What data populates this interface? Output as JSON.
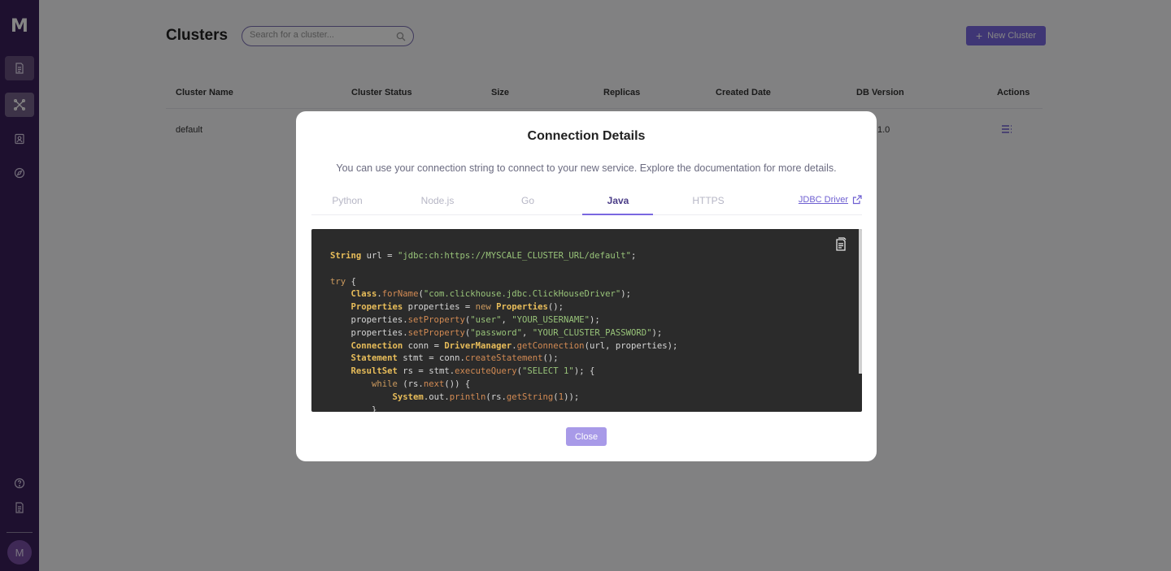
{
  "sidebar": {
    "logo": "M",
    "avatar_initial": "M",
    "items": [
      {
        "icon": "document-icon"
      },
      {
        "icon": "cluster-icon"
      },
      {
        "icon": "contacts-icon"
      },
      {
        "icon": "compass-icon"
      }
    ],
    "bottom_items": [
      {
        "icon": "help-icon"
      },
      {
        "icon": "docs-icon"
      }
    ]
  },
  "header": {
    "title": "Clusters",
    "search_placeholder": "Search for a cluster...",
    "new_cluster_label": "New Cluster"
  },
  "table": {
    "columns": [
      "Cluster Name",
      "Cluster Status",
      "Size",
      "Replicas",
      "Created Date",
      "DB Version",
      "Actions"
    ],
    "rows": [
      {
        "name": "default",
        "db_version_partial": "1.0"
      }
    ]
  },
  "modal": {
    "title": "Connection Details",
    "description": "You can use your connection string to connect to your new service. Explore the documentation for more details.",
    "tabs": [
      "Python",
      "Node.js",
      "Go",
      "Java",
      "HTTPS"
    ],
    "active_tab": "Java",
    "doc_link": "JDBC Driver",
    "close_label": "Close"
  },
  "colors": {
    "sidebar": "#3b1f5a",
    "accent": "#7a68e0",
    "code_bg": "#2b2b2b"
  }
}
